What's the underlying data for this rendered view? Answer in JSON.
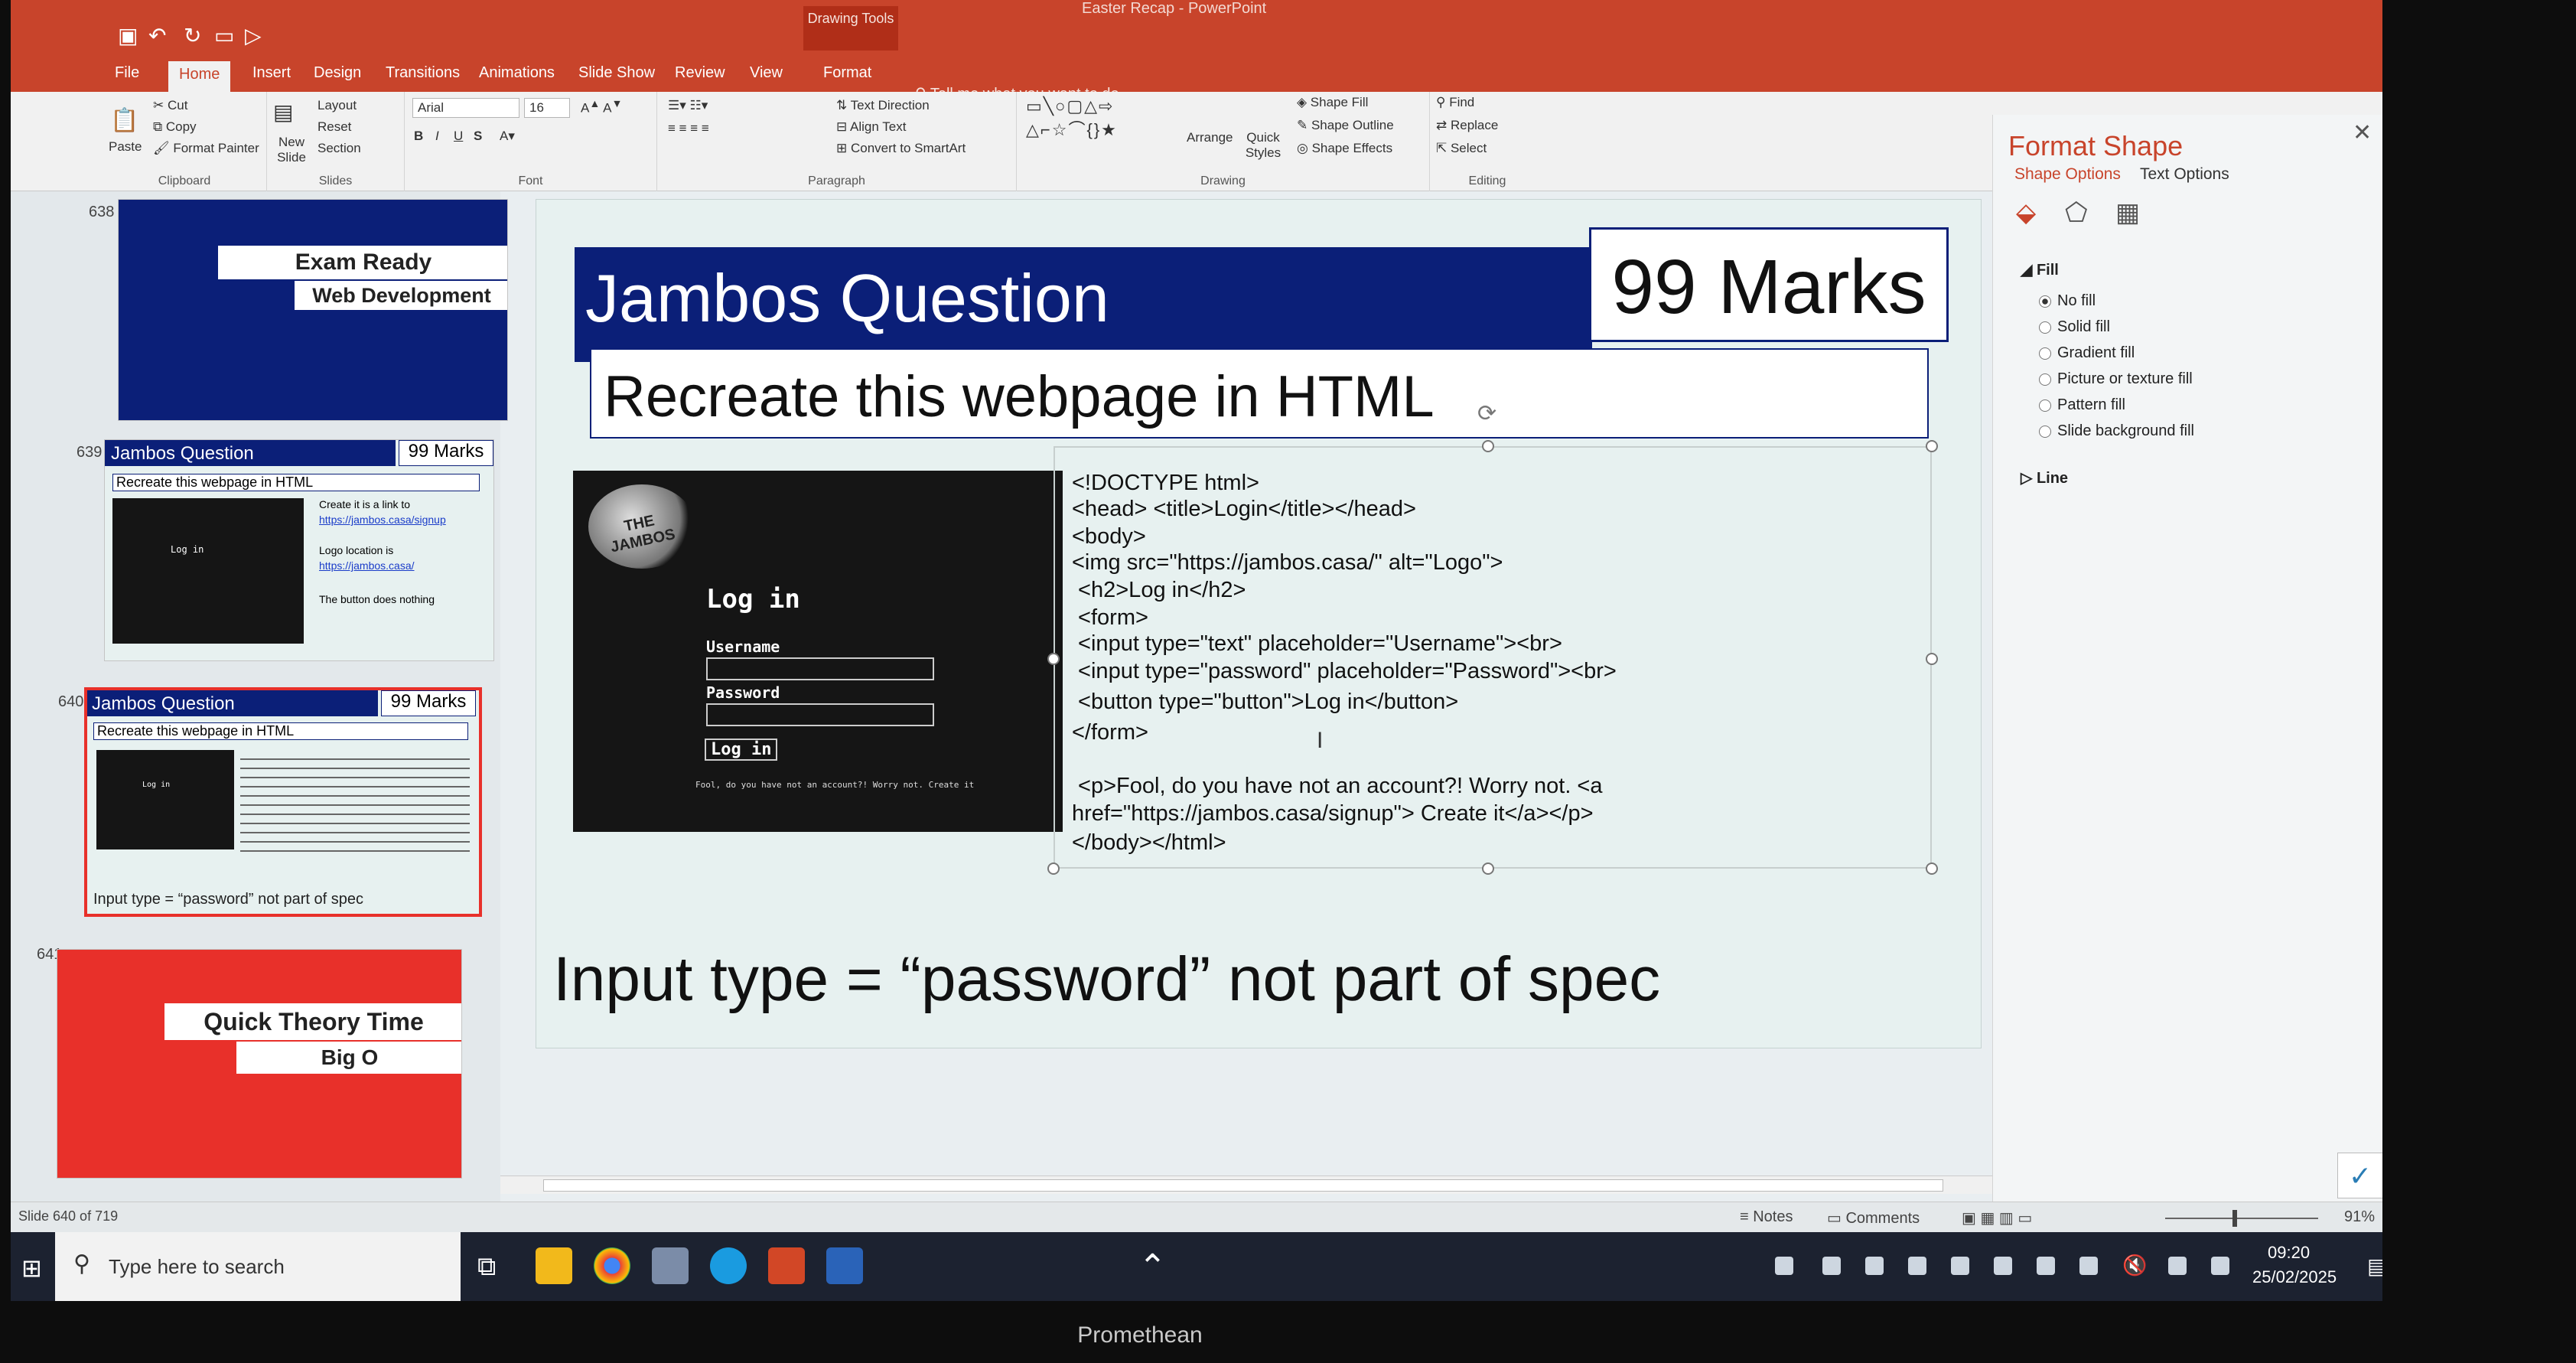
{
  "window": {
    "doc_title": "Easter Recap - PowerPoint",
    "context_tab": "Drawing Tools",
    "tell_me": "Tell me what you want to do..."
  },
  "tabs": [
    "File",
    "Home",
    "Insert",
    "Design",
    "Transitions",
    "Animations",
    "Slide Show",
    "Review",
    "View",
    "Format"
  ],
  "ribbon": {
    "clipboard": {
      "paste": "Paste",
      "cut": "Cut",
      "copy": "Copy",
      "format_painter": "Format Painter",
      "label": "Clipboard"
    },
    "slides": {
      "new_slide": "New Slide",
      "layout": "Layout",
      "reset": "Reset",
      "section": "Section",
      "label": "Slides"
    },
    "font": {
      "name": "Arial",
      "size": "16",
      "label": "Font"
    },
    "paragraph": {
      "text_direction": "Text Direction",
      "align_text": "Align Text",
      "convert": "Convert to SmartArt",
      "label": "Paragraph"
    },
    "drawing": {
      "arrange": "Arrange",
      "quick_styles": "Quick Styles",
      "shape_fill": "Shape Fill",
      "shape_outline": "Shape Outline",
      "shape_effects": "Shape Effects",
      "label": "Drawing"
    },
    "editing": {
      "find": "Find",
      "replace": "Replace",
      "select": "Select",
      "label": "Editing"
    }
  },
  "thumbnails": [
    {
      "num": "638",
      "line1": "Exam Ready",
      "line2": "Web Development"
    },
    {
      "num": "639",
      "title": "Jambos Question",
      "marks": "99 Marks",
      "sub": "Recreate this webpage in HTML",
      "n1": "Create it is a link to",
      "n1b": "https://jambos.casa/signup",
      "n2": "Logo location is",
      "n2b": "https://jambos.casa/",
      "n3": "The button does nothing",
      "img_title": "Log in"
    },
    {
      "num": "640",
      "title": "Jambos Question",
      "marks": "99 Marks",
      "sub": "Recreate this webpage in HTML",
      "note": "Input type = “password” not part of spec",
      "img_title": "Log in"
    },
    {
      "num": "641",
      "line1": "Quick Theory Time",
      "line2": "Big O"
    }
  ],
  "slide": {
    "title": "Jambos Question",
    "marks": "99 Marks",
    "subtitle": "Recreate this webpage in HTML",
    "login": {
      "logo": "THE JAMBOS",
      "heading": "Log in",
      "username_label": "Username",
      "password_label": "Password",
      "button": "Log in",
      "footer": "Fool, do you have not an account?! Worry not. Create it"
    },
    "code": [
      "<!DOCTYPE html>",
      "<head> <title>Login</title></head>",
      "<body>",
      "<img src=\"https://jambos.casa/\" alt=\"Logo\">",
      " <h2>Log in</h2>",
      " <form>",
      " <input type=\"text\" placeholder=\"Username\"><br>",
      " <input type=\"password\" placeholder=\"Password\"><br>",
      " <button type=\"button\">Log in</button>",
      "</form>",
      "",
      " <p>Fool, do you have not an account?! Worry not. <a",
      "href=\"https://jambos.casa/signup\"> Create it</a></p>",
      "</body></html>"
    ],
    "note": "Input type = “password” not part of spec"
  },
  "format_pane": {
    "title": "Format Shape",
    "tabs": [
      "Shape Options",
      "Text Options"
    ],
    "fill_header": "Fill",
    "fill_options": [
      "No fill",
      "Solid fill",
      "Gradient fill",
      "Picture or texture fill",
      "Pattern fill",
      "Slide background fill"
    ],
    "line_header": "Line"
  },
  "status": {
    "slide_info": "Slide 640 of 719",
    "notes": "Notes",
    "comments": "Comments",
    "zoom": "91%"
  },
  "taskbar": {
    "search": "Type here to search",
    "time": "09:20",
    "date": "25/02/2025"
  },
  "monitor_brand": "Promethean",
  "colors": {
    "accent": "#c8442b",
    "slide_header": "#0b1f78",
    "thumb_red": "#e8302a"
  }
}
